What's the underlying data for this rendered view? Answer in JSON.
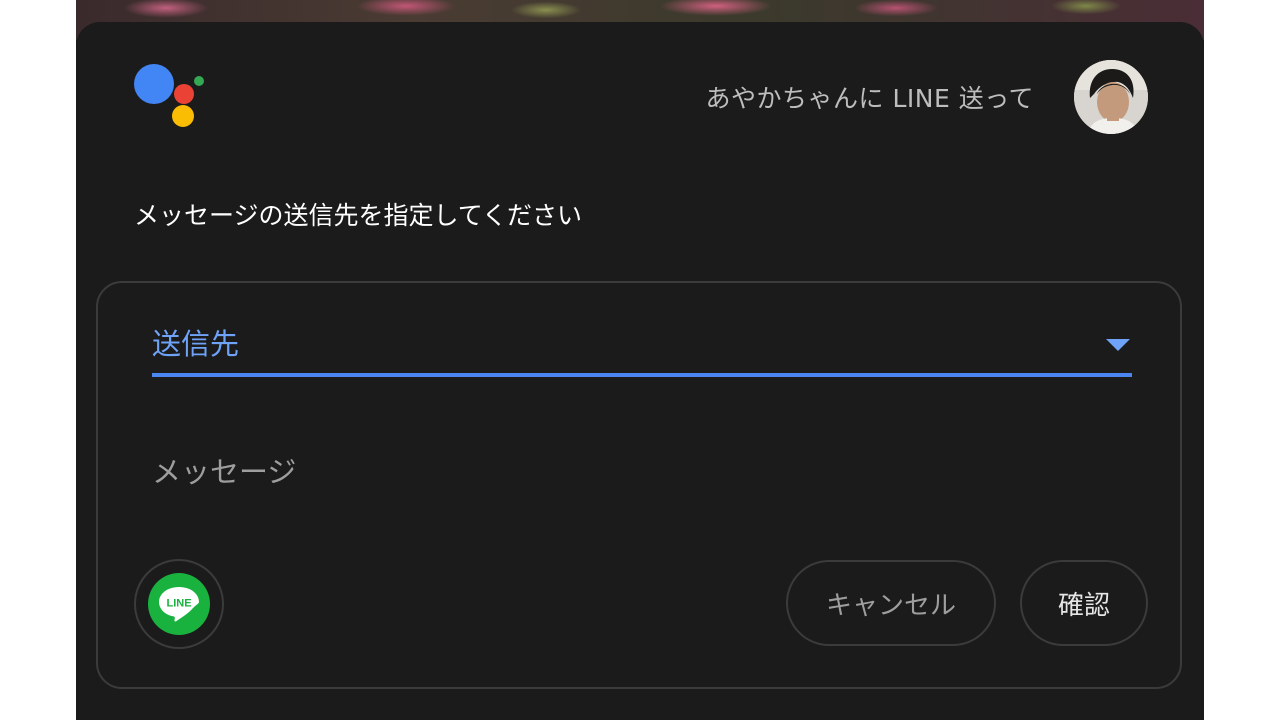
{
  "assistant": {
    "query": "あやかちゃんに LINE 送って",
    "prompt": "メッセージの送信先を指定してください"
  },
  "form": {
    "recipient_label": "送信先",
    "message_placeholder": "メッセージ",
    "app_icon_text": "LINE",
    "cancel_label": "キャンセル",
    "confirm_label": "確認"
  },
  "icons": {
    "assistant": "google-assistant-icon",
    "avatar": "user-avatar",
    "dropdown": "chevron-down-icon",
    "app": "line-app-icon"
  },
  "colors": {
    "background": "#1b1b1b",
    "accent": "#4b86f0",
    "line_green": "#19b23e",
    "logo_blue": "#4285f4",
    "logo_red": "#ea4335",
    "logo_yellow": "#fbbc04",
    "logo_green": "#34a853"
  }
}
